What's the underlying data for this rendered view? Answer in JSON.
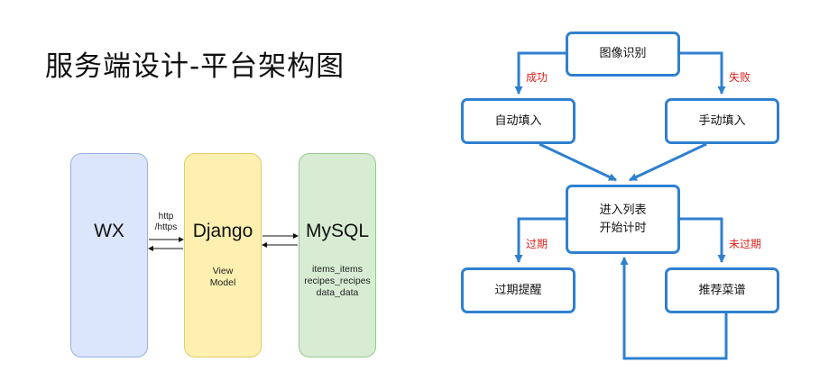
{
  "title": "服务端设计-平台架构图",
  "architecture": {
    "wx": {
      "name": "WX"
    },
    "django": {
      "name": "Django",
      "sub1": "View",
      "sub2": "Model"
    },
    "mysql": {
      "name": "MySQL",
      "sub1": "items_items",
      "sub2": "recipes_recipes",
      "sub3": "data_data"
    },
    "http_label_1": "http",
    "http_label_2": "/https"
  },
  "flow": {
    "image_recognition": "图像识别",
    "auto_fill": "自动填入",
    "manual_fill": "手动填入",
    "enter_list_1": "进入列表",
    "enter_list_2": "开始计时",
    "expired_reminder": "过期提醒",
    "recommend_recipes": "推荐菜谱",
    "edge_success": "成功",
    "edge_fail": "失败",
    "edge_expired": "过期",
    "edge_not_expired": "未过期"
  },
  "colors": {
    "flow_blue": "#2f80d0",
    "edge_label_red": "#e0201b",
    "wx_fill": "#dbe5fb",
    "django_fill": "#fdf0b0",
    "mysql_fill": "#d7ecd3"
  }
}
